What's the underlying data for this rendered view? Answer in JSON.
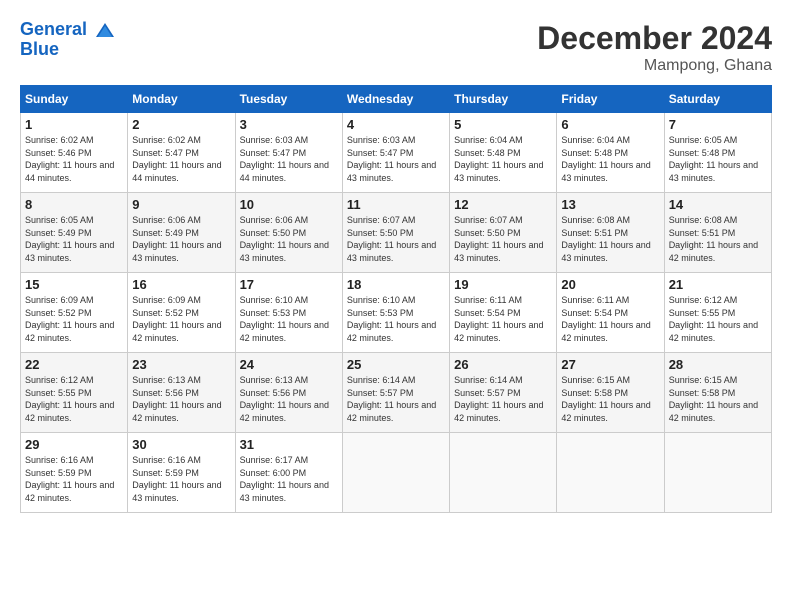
{
  "header": {
    "logo_line1": "General",
    "logo_line2": "Blue",
    "month_title": "December 2024",
    "location": "Mampong, Ghana"
  },
  "weekdays": [
    "Sunday",
    "Monday",
    "Tuesday",
    "Wednesday",
    "Thursday",
    "Friday",
    "Saturday"
  ],
  "weeks": [
    [
      {
        "day": "1",
        "sunrise": "6:02 AM",
        "sunset": "5:46 PM",
        "daylight": "11 hours and 44 minutes."
      },
      {
        "day": "2",
        "sunrise": "6:02 AM",
        "sunset": "5:47 PM",
        "daylight": "11 hours and 44 minutes."
      },
      {
        "day": "3",
        "sunrise": "6:03 AM",
        "sunset": "5:47 PM",
        "daylight": "11 hours and 44 minutes."
      },
      {
        "day": "4",
        "sunrise": "6:03 AM",
        "sunset": "5:47 PM",
        "daylight": "11 hours and 43 minutes."
      },
      {
        "day": "5",
        "sunrise": "6:04 AM",
        "sunset": "5:48 PM",
        "daylight": "11 hours and 43 minutes."
      },
      {
        "day": "6",
        "sunrise": "6:04 AM",
        "sunset": "5:48 PM",
        "daylight": "11 hours and 43 minutes."
      },
      {
        "day": "7",
        "sunrise": "6:05 AM",
        "sunset": "5:48 PM",
        "daylight": "11 hours and 43 minutes."
      }
    ],
    [
      {
        "day": "8",
        "sunrise": "6:05 AM",
        "sunset": "5:49 PM",
        "daylight": "11 hours and 43 minutes."
      },
      {
        "day": "9",
        "sunrise": "6:06 AM",
        "sunset": "5:49 PM",
        "daylight": "11 hours and 43 minutes."
      },
      {
        "day": "10",
        "sunrise": "6:06 AM",
        "sunset": "5:50 PM",
        "daylight": "11 hours and 43 minutes."
      },
      {
        "day": "11",
        "sunrise": "6:07 AM",
        "sunset": "5:50 PM",
        "daylight": "11 hours and 43 minutes."
      },
      {
        "day": "12",
        "sunrise": "6:07 AM",
        "sunset": "5:50 PM",
        "daylight": "11 hours and 43 minutes."
      },
      {
        "day": "13",
        "sunrise": "6:08 AM",
        "sunset": "5:51 PM",
        "daylight": "11 hours and 43 minutes."
      },
      {
        "day": "14",
        "sunrise": "6:08 AM",
        "sunset": "5:51 PM",
        "daylight": "11 hours and 42 minutes."
      }
    ],
    [
      {
        "day": "15",
        "sunrise": "6:09 AM",
        "sunset": "5:52 PM",
        "daylight": "11 hours and 42 minutes."
      },
      {
        "day": "16",
        "sunrise": "6:09 AM",
        "sunset": "5:52 PM",
        "daylight": "11 hours and 42 minutes."
      },
      {
        "day": "17",
        "sunrise": "6:10 AM",
        "sunset": "5:53 PM",
        "daylight": "11 hours and 42 minutes."
      },
      {
        "day": "18",
        "sunrise": "6:10 AM",
        "sunset": "5:53 PM",
        "daylight": "11 hours and 42 minutes."
      },
      {
        "day": "19",
        "sunrise": "6:11 AM",
        "sunset": "5:54 PM",
        "daylight": "11 hours and 42 minutes."
      },
      {
        "day": "20",
        "sunrise": "6:11 AM",
        "sunset": "5:54 PM",
        "daylight": "11 hours and 42 minutes."
      },
      {
        "day": "21",
        "sunrise": "6:12 AM",
        "sunset": "5:55 PM",
        "daylight": "11 hours and 42 minutes."
      }
    ],
    [
      {
        "day": "22",
        "sunrise": "6:12 AM",
        "sunset": "5:55 PM",
        "daylight": "11 hours and 42 minutes."
      },
      {
        "day": "23",
        "sunrise": "6:13 AM",
        "sunset": "5:56 PM",
        "daylight": "11 hours and 42 minutes."
      },
      {
        "day": "24",
        "sunrise": "6:13 AM",
        "sunset": "5:56 PM",
        "daylight": "11 hours and 42 minutes."
      },
      {
        "day": "25",
        "sunrise": "6:14 AM",
        "sunset": "5:57 PM",
        "daylight": "11 hours and 42 minutes."
      },
      {
        "day": "26",
        "sunrise": "6:14 AM",
        "sunset": "5:57 PM",
        "daylight": "11 hours and 42 minutes."
      },
      {
        "day": "27",
        "sunrise": "6:15 AM",
        "sunset": "5:58 PM",
        "daylight": "11 hours and 42 minutes."
      },
      {
        "day": "28",
        "sunrise": "6:15 AM",
        "sunset": "5:58 PM",
        "daylight": "11 hours and 42 minutes."
      }
    ],
    [
      {
        "day": "29",
        "sunrise": "6:16 AM",
        "sunset": "5:59 PM",
        "daylight": "11 hours and 42 minutes."
      },
      {
        "day": "30",
        "sunrise": "6:16 AM",
        "sunset": "5:59 PM",
        "daylight": "11 hours and 43 minutes."
      },
      {
        "day": "31",
        "sunrise": "6:17 AM",
        "sunset": "6:00 PM",
        "daylight": "11 hours and 43 minutes."
      },
      null,
      null,
      null,
      null
    ]
  ]
}
